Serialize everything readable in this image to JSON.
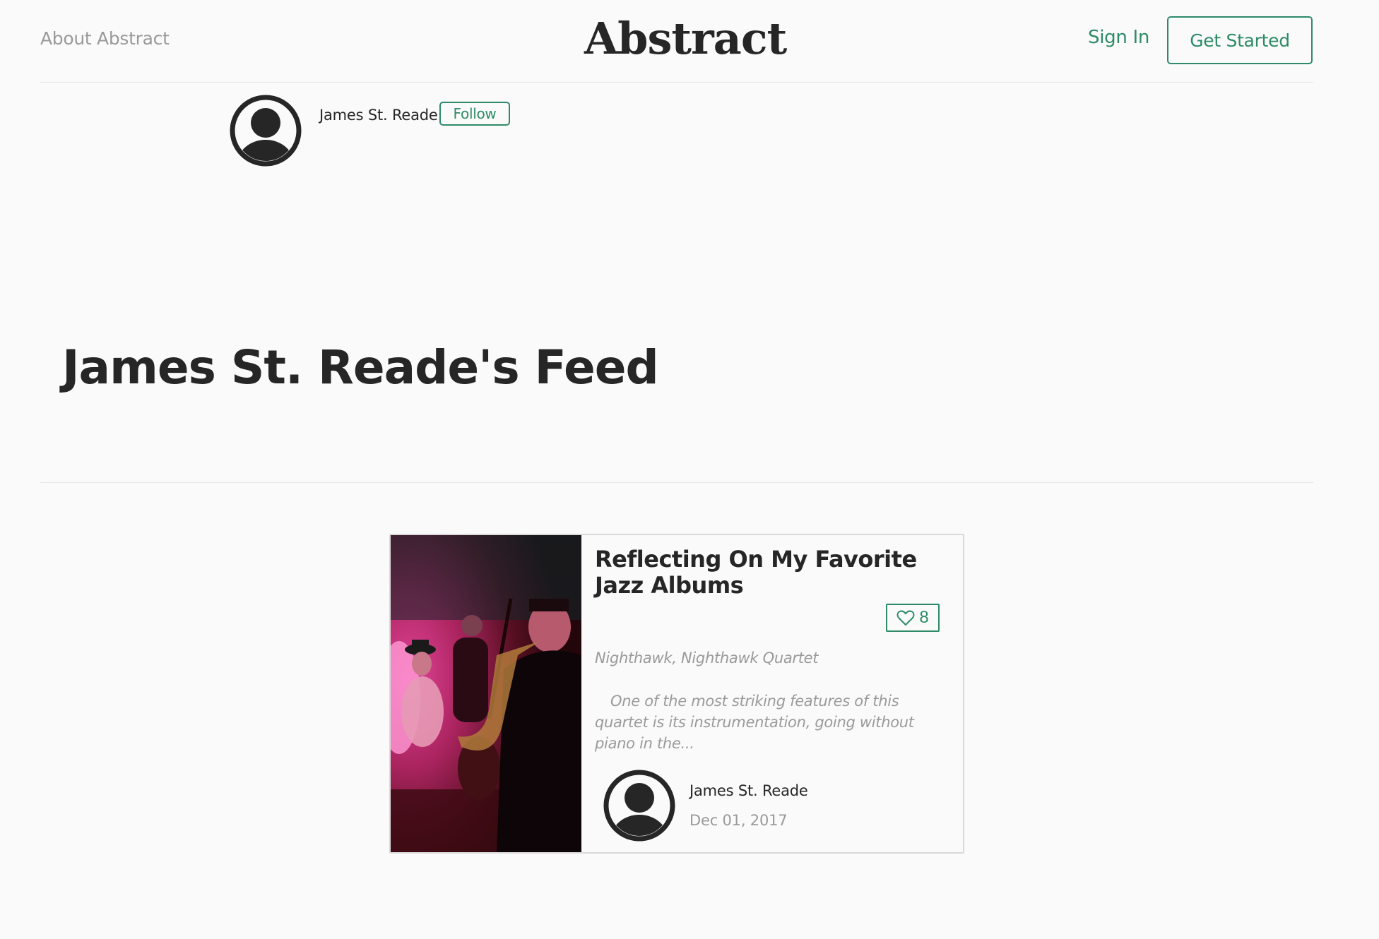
{
  "header": {
    "about_label": "About Abstract",
    "brand": "Abstract",
    "sign_in_label": "Sign In",
    "get_started_label": "Get Started"
  },
  "author": {
    "name": "James St. Reade",
    "follow_label": "Follow",
    "avatar_icon": "user-avatar-icon"
  },
  "feed": {
    "title": "James St. Reade's Feed"
  },
  "post": {
    "title": "Reflecting On My Favorite Jazz Albums",
    "likes": "8",
    "like_icon": "heart-outline-icon",
    "source": "Nighthawk, Nighthawk Quartet",
    "excerpt": "One of the most striking features of this quartet is its instrumentation, going without piano in the...",
    "author_name": "James St. Reade",
    "date": "Dec 01, 2017"
  },
  "colors": {
    "accent": "#2e8b68",
    "text": "#262626",
    "muted": "#9a9a9a",
    "background": "#fafafa",
    "divider": "#e6e6e6"
  }
}
